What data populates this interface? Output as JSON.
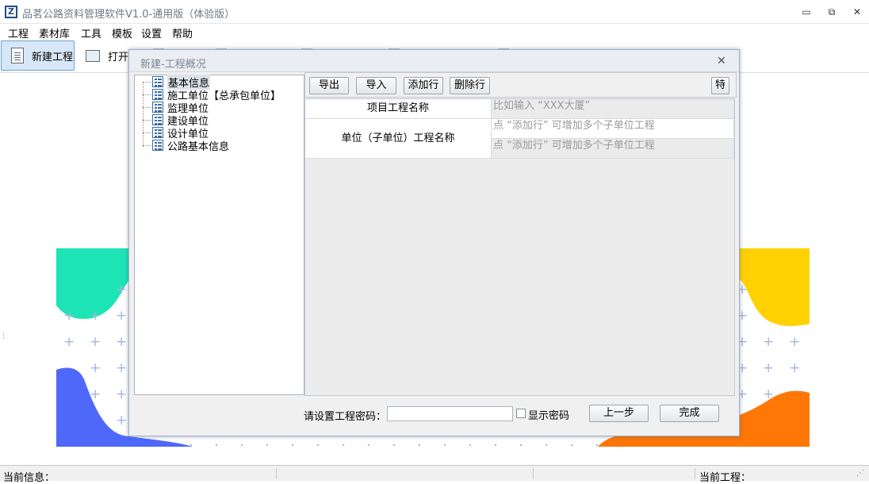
{
  "app": {
    "logo": "Z",
    "title": "品茗公路资料管理软件V1.0-通用版（体验版）"
  },
  "window_controls": {
    "minimize": "▭",
    "restore": "⧉",
    "close": "✕"
  },
  "menu": [
    "工程",
    "素材库",
    "工具",
    "模板",
    "设置",
    "帮助"
  ],
  "toolbar": {
    "new_project": "新建工程",
    "open": "打开"
  },
  "dialog": {
    "title": "新建-工程概况",
    "close": "✕",
    "tree": [
      "基本信息",
      "施工单位【总承包单位】",
      "监理单位",
      "建设单位",
      "设计单位",
      "公路基本信息"
    ],
    "buttons": {
      "export": "导出",
      "import": "导入",
      "add_row": "添加行",
      "delete_row": "删除行",
      "special": "特"
    },
    "grid": {
      "project_name_label": "项目工程名称",
      "project_name_placeholder": "比如输入 “XXX大厦”",
      "unit_name_label": "单位（子单位）工程名称",
      "unit_placeholder_1": "点 “添加行” 可增加多个子单位工程",
      "unit_placeholder_2": "点 “添加行” 可增加多个子单位工程"
    },
    "password_label": "请设置工程密码：",
    "show_password": "显示密码",
    "prev_button": "上一步",
    "finish_button": "完成"
  },
  "status": {
    "current_info": "当前信息：",
    "current_project": "当前工程："
  },
  "colors": {
    "teal": "#1de4b5",
    "blue": "#4e68fa",
    "yellow": "#ffd100",
    "orange": "#ff7707",
    "selection": "#d8e7f8"
  }
}
